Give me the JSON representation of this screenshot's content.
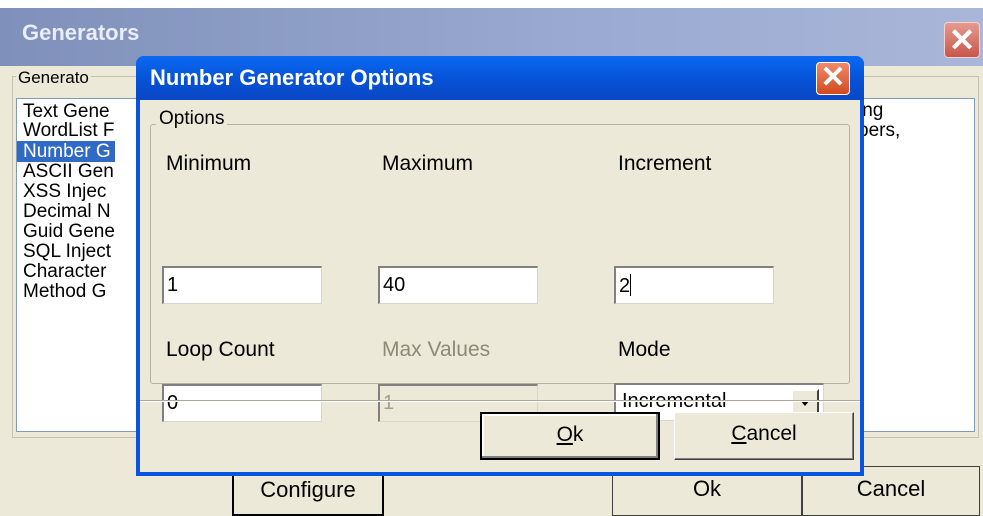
{
  "background_dialog": {
    "title": "Generators",
    "group_label": "Generato",
    "list_items": [
      "Text Gene",
      "WordList F",
      "Number G",
      "ASCII Gen",
      "XSS Injec",
      "Decimal N",
      "Guid Gene",
      "SQL Inject",
      "Character",
      "Method G"
    ],
    "selected_index": 2,
    "description_lines": [
      "ing",
      "bers,"
    ],
    "buttons": {
      "configure": "Configure",
      "ok": "Ok",
      "cancel": "Cancel"
    }
  },
  "dialog": {
    "title": "Number Generator Options",
    "group_label": "Options",
    "fields": {
      "minimum": {
        "label": "Minimum",
        "value": "1"
      },
      "maximum": {
        "label": "Maximum",
        "value": "40"
      },
      "increment": {
        "label": "Increment",
        "value": "2"
      },
      "loop_count": {
        "label": "Loop Count",
        "value": "0"
      },
      "max_values": {
        "label": "Max Values",
        "value": "1",
        "disabled": true
      },
      "mode": {
        "label": "Mode",
        "value": "Incremental"
      }
    },
    "buttons": {
      "ok": {
        "mnemonic": "O",
        "rest": "k"
      },
      "cancel": {
        "mnemonic": "C",
        "rest": "ancel"
      }
    }
  },
  "colors": {
    "titlebar_active": "#0653d8",
    "titlebar_inactive": "#9aaad2",
    "selection": "#316ac5",
    "face": "#ece9d8",
    "disabled_text": "#8a8a76"
  }
}
